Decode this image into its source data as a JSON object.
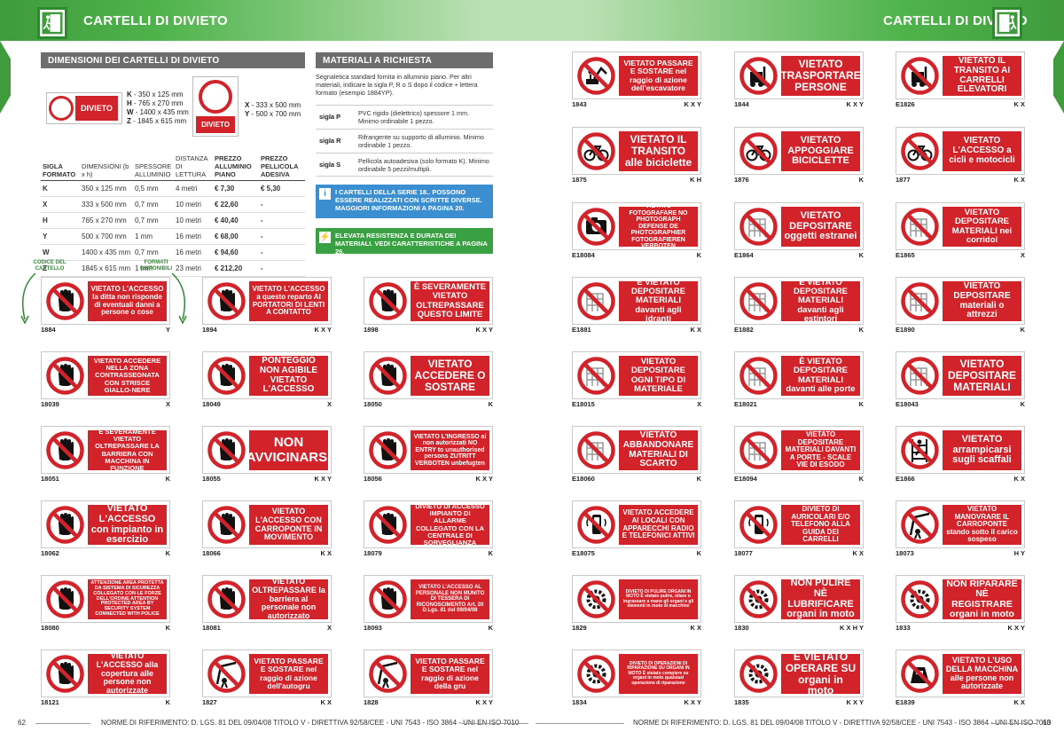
{
  "header": {
    "title_left": "CARTELLI DI DIVIETO",
    "title_right": "CARTELLI DI DIVIETO",
    "exit_icon": "exit-door-icon",
    "color": "#3f9b3c"
  },
  "dimensions_section": {
    "title": "DIMENSIONI DEI CARTELLI DI DIVIETO",
    "sample_sign_text": "DIVIETO",
    "specs_left": [
      {
        "k": "K",
        "v": " - 350 x 125 mm"
      },
      {
        "k": "H",
        "v": " - 765 x 270 mm"
      },
      {
        "k": "W",
        "v": " - 1400 x 435 mm"
      },
      {
        "k": "Z",
        "v": " - 1845 x 615 mm"
      }
    ],
    "specs_right": [
      {
        "k": "X",
        "v": " - 333 x 500 mm"
      },
      {
        "k": "Y",
        "v": " - 500 x 700 mm"
      }
    ],
    "table_headers": [
      "SIGLA FORMATO",
      "DIMENSIONI (b x h)",
      "SPESSORE ALLUMINIO",
      "DISTANZA DI LETTURA",
      "PREZZO ALLUMINIO PIANO",
      "PREZZO PELLICOLA ADESIVA"
    ],
    "rows": [
      [
        "K",
        "350 x 125 mm",
        "0,5 mm",
        "4 metri",
        "€ 7,30",
        "€ 5,30"
      ],
      [
        "X",
        "333 x 500 mm",
        "0,7 mm",
        "10 metri",
        "€ 22,60",
        "-"
      ],
      [
        "H",
        "765 x 270 mm",
        "0,7 mm",
        "10 metri",
        "€ 40,40",
        "-"
      ],
      [
        "Y",
        "500 x 700 mm",
        "1 mm",
        "16 metri",
        "€ 68,00",
        "-"
      ],
      [
        "W",
        "1400 x 435 mm",
        "0,7 mm",
        "16 metri",
        "€ 94,60",
        "-"
      ],
      [
        "Z",
        "1845 x 615 mm",
        "1 mm",
        "23 metri",
        "€ 212,20",
        "-"
      ]
    ]
  },
  "materials": {
    "title": "MATERIALI A RICHIESTA",
    "intro": "Segnaletica standard fornita in alluminio piano. Per altri materiali, indicare la sigla P, R o S dopo il codice + lettera formato (esempio 1884YP).",
    "items": [
      {
        "k": "sigla P",
        "v": "PVC rigido (dielettrico) spessore 1 mm. Minimo ordinabile 1 pezzo."
      },
      {
        "k": "sigla R",
        "v": "Rifrangente su supporto di alluminio. Minimo ordinabile 1 pezzo."
      },
      {
        "k": "sigla S",
        "v": "Pellicola autoadesiva (solo formato K). Minimo ordinabile 5 pezzi/multipli."
      }
    ],
    "info_blue": "I CARTELLI DELLA SERIE 18.. POSSONO ESSERE REALIZZATI CON SCRITTE DIVERSE. MAGGIORI INFORMAZIONI A PAGINA 20.",
    "info_green": "ELEVATA RESISTENZA E DURATA DEI MATERIALI. VEDI CARATTERISTICHE A PAGINA 26.",
    "blue": "#3b8fd0",
    "green": "#3aa142"
  },
  "legend": {
    "code_label": "CODICE DEL CARTELLO",
    "format_label": "FORMATI DISPONIBILI"
  },
  "signs": [
    {
      "code": "1884",
      "fmt": "Y",
      "text": "VIETATO L'ACCESSO la ditta non risponde di eventuali danni a persone o cose",
      "icon": "hand-stop-icon",
      "fs": 8
    },
    {
      "code": "1894",
      "fmt": "K X Y",
      "text": "VIETATO L'ACCESSO a questo reparto AI PORTATORI DI LENTI A CONTATTO",
      "icon": "hand-stop-icon",
      "fs": 8
    },
    {
      "code": "1898",
      "fmt": "K X Y",
      "text": "È SEVERAMENTE VIETATO OLTREPASSARE QUESTO LIMITE",
      "icon": "hand-stop-icon",
      "fs": 9.5
    },
    {
      "code": "18039",
      "fmt": "X",
      "text": "VIETATO ACCEDERE NELLA ZONA CONTRASSEGNATA CON STRISCE GIALLO-NERE",
      "icon": "hand-stop-icon",
      "fs": 7.5
    },
    {
      "code": "18049",
      "fmt": "X",
      "text": "PONTEGGIO NON AGIBILE VIETATO L'ACCESSO",
      "icon": "hand-stop-icon",
      "fs": 10
    },
    {
      "code": "18050",
      "fmt": "K",
      "text": "VIETATO ACCEDERE O SOSTARE",
      "icon": "hand-stop-icon",
      "fs": 12
    },
    {
      "code": "18051",
      "fmt": "K",
      "text": "È SEVERAMENTE VIETATO OLTREPASSARE LA BARRIERA CON MACCHINA IN FUNZIONE",
      "icon": "hand-stop-icon",
      "fs": 7.5
    },
    {
      "code": "18055",
      "fmt": "K X Y",
      "text": "NON AVVICINARSI",
      "icon": "hand-stop-icon",
      "fs": 15
    },
    {
      "code": "18056",
      "fmt": "K X Y",
      "text": "VIETATO L'INGRESSO ai non autorizzati NO ENTRY to unauthorised persons ZUTRITT VERBOTEN unbefugten",
      "icon": "hand-stop-icon",
      "fs": 7
    },
    {
      "code": "18062",
      "fmt": "K",
      "text": "VIETATO L'ACCESSO con impianto in esercizio",
      "icon": "hand-stop-icon",
      "fs": 11
    },
    {
      "code": "18066",
      "fmt": "K X",
      "text": "VIETATO L'ACCESSO CON CARROPONTE IN MOVIMENTO",
      "icon": "hand-stop-icon",
      "fs": 9
    },
    {
      "code": "18079",
      "fmt": "K",
      "text": "DIVIETO DI ACCESSO IMPIANTO DI ALLARME COLLEGATO CON LA CENTRALE DI SORVEGLIANZA",
      "icon": "hand-stop-icon",
      "fs": 7.5
    },
    {
      "code": "18080",
      "fmt": "K",
      "text": "ATTENZIONE AREA PROTETTA DA SISTEMA DI SICUREZZA COLLEGATO CON LE FORZE DELL'ORDINE ATTENTION PROTECTED AREA BY SECURITY SYSTEM CONNECTED WITH POLICE",
      "icon": "hand-stop-icon",
      "fs": 5.5
    },
    {
      "code": "18081",
      "fmt": "X",
      "text": "VIETATO OLTREPASSARE la barriera al personale non autorizzato",
      "icon": "hand-stop-icon",
      "fs": 9
    },
    {
      "code": "18093",
      "fmt": "K",
      "text": "VIETATO L'ACCESSO AL PERSONALE NON MUNITO DI TESSERA DI RICONOSCIMENTO Art. 20 D.Lgs. 81 del 09/04/08",
      "icon": "hand-stop-icon",
      "fs": 6
    },
    {
      "code": "18121",
      "fmt": "K",
      "text": "VIETATO L'ACCESSO alla copertura alle persone non autorizzate",
      "icon": "hand-stop-icon",
      "fs": 9
    },
    {
      "code": "1827",
      "fmt": "K X",
      "text": "VIETATO PASSARE E SOSTARE nel raggio di azione dell'autogru",
      "icon": "crane-icon",
      "fs": 8.5
    },
    {
      "code": "1828",
      "fmt": "K X Y",
      "text": "VIETATO PASSARE E SOSTARE nel raggio di azione della gru",
      "icon": "crane-icon",
      "fs": 8.5
    },
    {
      "code": "1843",
      "fmt": "K X Y",
      "text": "VIETATO PASSARE E SOSTARE nel raggio di azione dell'escavatore",
      "icon": "excavator-icon",
      "fs": 8.5
    },
    {
      "code": "1844",
      "fmt": "K X Y",
      "text": "VIETATO TRASPORTARE PERSONE",
      "icon": "forklift-icon",
      "fs": 12
    },
    {
      "code": "E1826",
      "fmt": "K X",
      "text": "VIETATO IL TRANSITO AI CARRELLI ELEVATORI",
      "icon": "forklift-icon",
      "fs": 10
    },
    {
      "code": "1875",
      "fmt": "K H",
      "text": "VIETATO IL TRANSITO alle biciclette",
      "icon": "bicycle-icon",
      "fs": 12
    },
    {
      "code": "1876",
      "fmt": "K",
      "text": "VIETATO APPOGGIARE BICICLETTE",
      "icon": "bicycle-icon",
      "fs": 11
    },
    {
      "code": "1877",
      "fmt": "K X",
      "text": "VIETATO L'ACCESSO a cicli e motocicli",
      "icon": "bicycle-icon",
      "fs": 10
    },
    {
      "code": "E18084",
      "fmt": "K",
      "text": "VIETATO FOTOGRAFARE NO PHOTOGRAPH DEFENSE DE PHOTOGRAPHIER FOTOGRAFIEREN VERBOTEN",
      "icon": "camera-icon",
      "fs": 7
    },
    {
      "code": "E1864",
      "fmt": "K",
      "text": "VIETATO DEPOSITARE oggetti estranei",
      "icon": "boxes-icon",
      "fs": 11
    },
    {
      "code": "E1865",
      "fmt": "X",
      "text": "VIETATO DEPOSITARE MATERIALI nei corridoi",
      "icon": "boxes-icon",
      "fs": 9.5
    },
    {
      "code": "E1881",
      "fmt": "K X",
      "text": "È VIETATO DEPOSITARE MATERIALI davanti agli idranti",
      "icon": "boxes-icon",
      "fs": 9.5
    },
    {
      "code": "E1882",
      "fmt": "K",
      "text": "È VIETATO DEPOSITARE MATERIALI davanti agli estintori",
      "icon": "boxes-icon",
      "fs": 9.5
    },
    {
      "code": "E1890",
      "fmt": "K",
      "text": "VIETATO DEPOSITARE materiali o attrezzi",
      "icon": "boxes-icon",
      "fs": 10
    },
    {
      "code": "E18015",
      "fmt": "X",
      "text": "VIETATO DEPOSITARE OGNI TIPO DI MATERIALE",
      "icon": "boxes-icon",
      "fs": 9.5
    },
    {
      "code": "E18021",
      "fmt": "K",
      "text": "È VIETATO DEPOSITARE MATERIALI davanti alle porte",
      "icon": "boxes-icon",
      "fs": 9.5
    },
    {
      "code": "E18043",
      "fmt": "K",
      "text": "VIETATO DEPOSITARE MATERIALI",
      "icon": "boxes-icon",
      "fs": 12
    },
    {
      "code": "E18060",
      "fmt": "K",
      "text": "VIETATO ABBANDONARE MATERIALI DI SCARTO",
      "icon": "boxes-icon",
      "fs": 10
    },
    {
      "code": "E18094",
      "fmt": "K",
      "text": "VIETATO DEPOSITARE MATERIALI DAVANTI A PORTE - SCALE VIE DI ESODO",
      "icon": "boxes-icon",
      "fs": 8
    },
    {
      "code": "E1866",
      "fmt": "K X",
      "text": "VIETATO arrampicarsi sugli scaffali",
      "icon": "shelf-icon",
      "fs": 11
    },
    {
      "code": "E18075",
      "fmt": "K",
      "text": "VIETATO ACCEDERE AI LOCALI CON APPARECCHI RADIO E TELEFONICI ATTIVI",
      "icon": "phone-icon",
      "fs": 8
    },
    {
      "code": "18077",
      "fmt": "K X",
      "text": "DIVIETO DI AURICOLARI E/O TELEFONO ALLA GUIDA DEI CARRELLI",
      "icon": "phone-icon",
      "fs": 8
    },
    {
      "code": "18073",
      "fmt": "H Y",
      "text": "VIETATO MANOVRARE IL CARROPONTE stando sotto il carico sospeso",
      "icon": "crane-icon",
      "fs": 8
    },
    {
      "code": "1829",
      "fmt": "K X",
      "text": "DIVIETO DI PULIRE ORGANI IN MOTO È vietato pulire, oliare o ingrassare a mano gli organi e gli elementi in moto di macchine",
      "icon": "gear-icon",
      "fs": 5
    },
    {
      "code": "1830",
      "fmt": "K X H Y",
      "text": "NON PULIRE NÈ LUBRIFICARE organi in moto",
      "icon": "gear-icon",
      "fs": 11
    },
    {
      "code": "1833",
      "fmt": "K X Y",
      "text": "NON RIPARARE NÈ REGISTRARE organi in moto",
      "icon": "gear-icon",
      "fs": 10.5
    },
    {
      "code": "1834",
      "fmt": "K X Y",
      "text": "DIVIETO DI OPERAZIONI DI RIPARAZIONE SU ORGANI IN MOTO È vietato compiere su organi in moto qualsiasi operazione di riparazione",
      "icon": "gear-icon",
      "fs": 5
    },
    {
      "code": "1835",
      "fmt": "K X Y",
      "text": "È VIETATO OPERARE SU organi in moto",
      "icon": "gear-icon",
      "fs": 12
    },
    {
      "code": "E1839",
      "fmt": "K X",
      "text": "VIETATO L'USO DELLA MACCHINA alle persone non autorizzate",
      "icon": "machine-icon",
      "fs": 9
    }
  ],
  "footer": {
    "page_left": "62",
    "page_right": "63",
    "norms": "NORME DI RIFERIMENTO: D. LGS. 81 DEL 09/04/08 TITOLO V - DIRETTIVA 92/58/CEE - UNI 7543 - ISO 3864 - UNI EN ISO 7010"
  }
}
